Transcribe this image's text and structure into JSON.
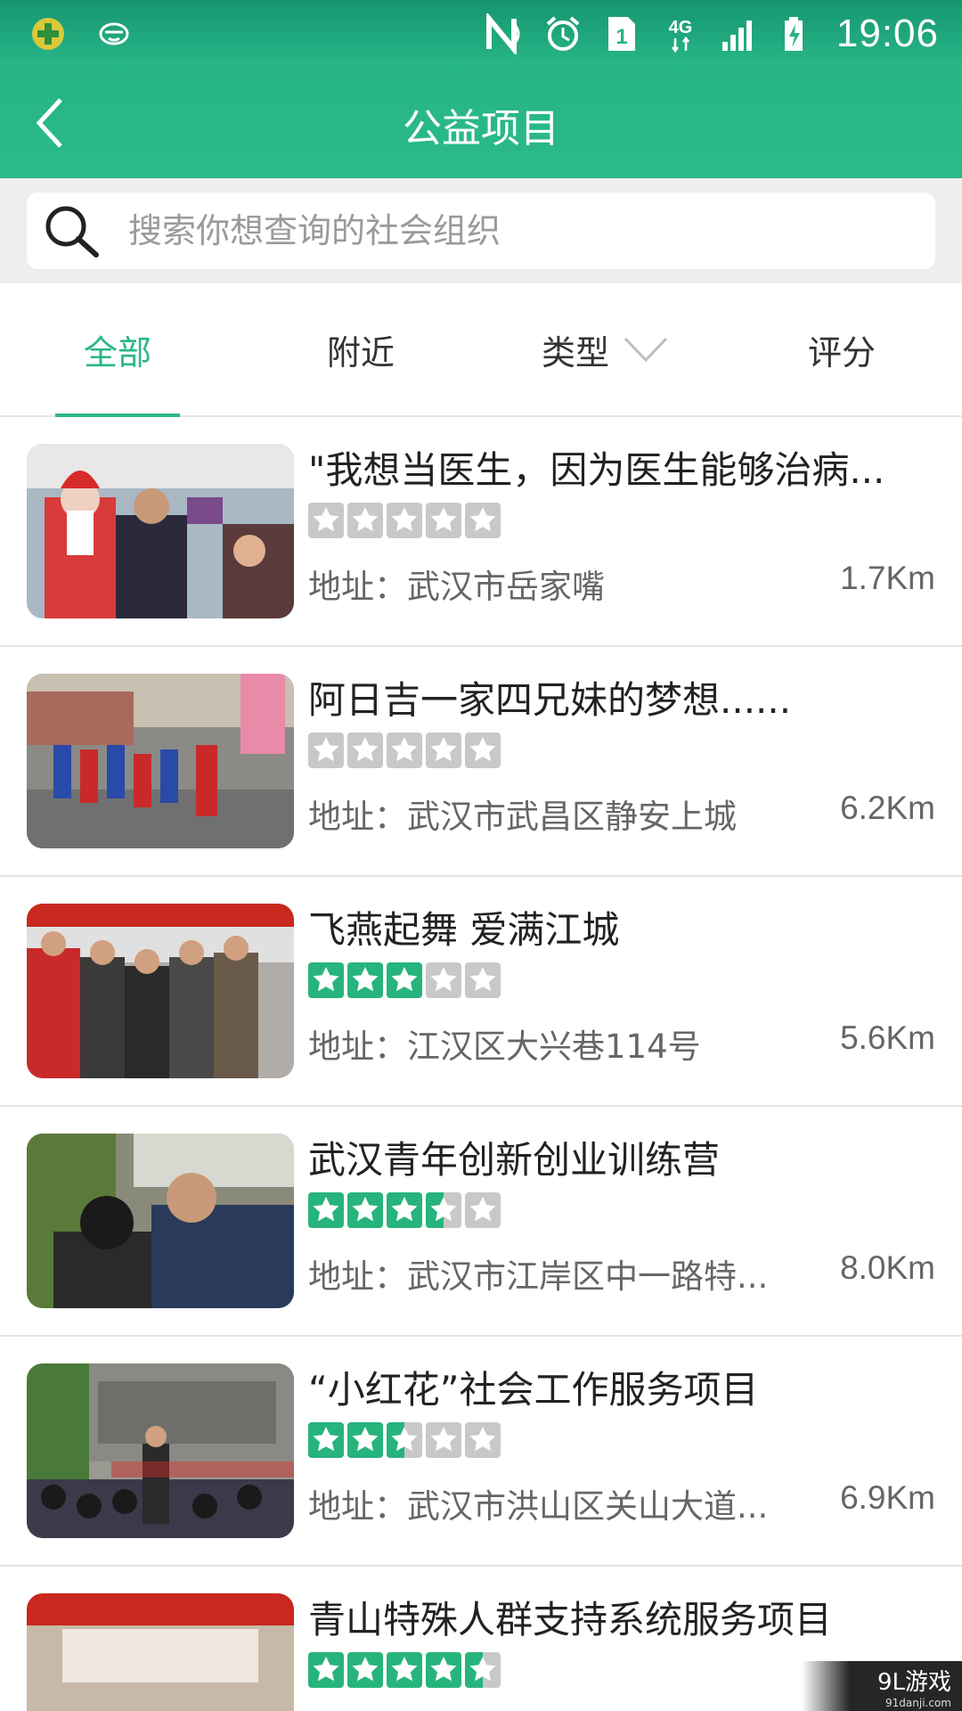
{
  "status_bar": {
    "time": "19:06",
    "network": "4G",
    "sim": "1"
  },
  "header": {
    "title": "公益项目"
  },
  "search": {
    "placeholder": "搜索你想查询的社会组织",
    "value": ""
  },
  "tabs": [
    {
      "label": "全部",
      "active": true
    },
    {
      "label": "附近",
      "active": false
    },
    {
      "label": "类型",
      "active": false
    },
    {
      "label": "评分",
      "active": false
    }
  ],
  "items": [
    {
      "title": "\"我想当医生，因为医生能够治病...",
      "rating": 0,
      "address": "地址：武汉市岳家嘴",
      "distance": "1.7Km"
    },
    {
      "title": "阿日吉一家四兄妹的梦想......",
      "rating": 0,
      "address": "地址：武汉市武昌区静安上城",
      "distance": "6.2Km"
    },
    {
      "title": "飞燕起舞 爱满江城",
      "rating": 3,
      "address": "地址：江汉区大兴巷114号",
      "distance": "5.6Km"
    },
    {
      "title": "武汉青年创新创业训练营",
      "rating": 3.5,
      "address": "地址：武汉市江岸区中一路特...",
      "distance": "8.0Km"
    },
    {
      "title": "“小红花”社会工作服务项目",
      "rating": 2.5,
      "address": "地址：武汉市洪山区关山大道...",
      "distance": "6.9Km"
    },
    {
      "title": "青山特殊人群支持系统服务项目",
      "rating": 4.5,
      "address": "",
      "distance": ""
    }
  ],
  "colors": {
    "accent": "#2ab68a",
    "star_on": "#27b47c",
    "star_off": "#c8c8c8"
  },
  "watermark": {
    "brand": "9L游戏",
    "site": "91danji.com"
  }
}
